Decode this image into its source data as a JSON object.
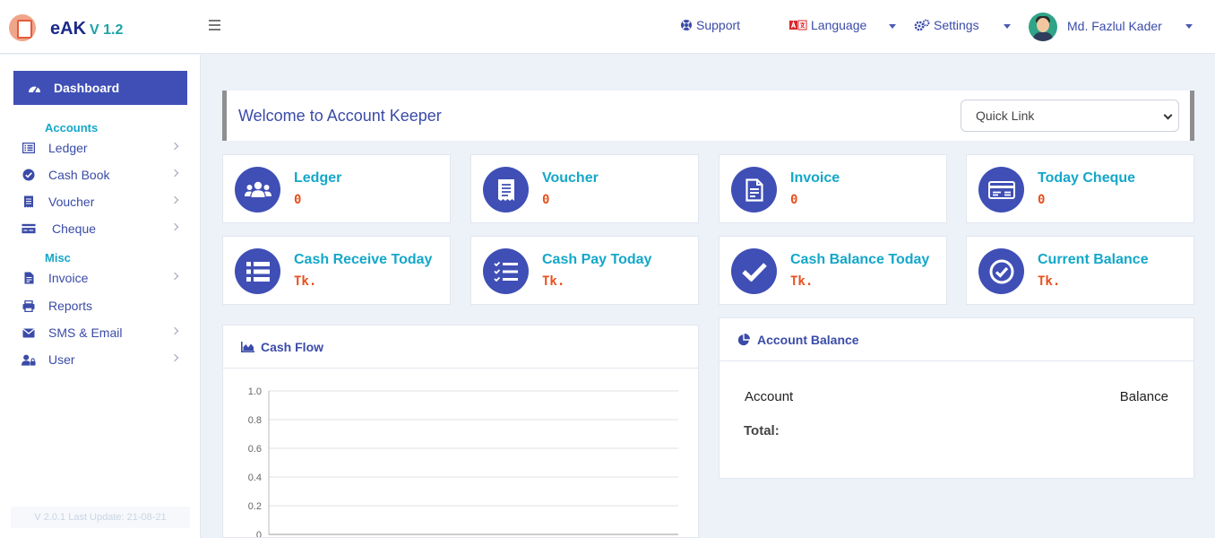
{
  "brand": {
    "name": "eAK",
    "version": "V 1.2"
  },
  "topnav": {
    "support": "Support",
    "language": "Language",
    "settings": "Settings",
    "user_name": "Md. Fazlul Kader"
  },
  "sidebar": {
    "dashboard": "Dashboard",
    "sections": {
      "accounts": "Accounts",
      "misc": "Misc"
    },
    "items": [
      {
        "label": "Ledger",
        "icon": "list-icon"
      },
      {
        "label": "Cash Book",
        "icon": "check-circle-icon"
      },
      {
        "label": "Voucher",
        "icon": "receipt-icon"
      },
      {
        "label": "Cheque",
        "icon": "card-icon"
      },
      {
        "label": "Invoice",
        "icon": "file-icon"
      },
      {
        "label": "Reports",
        "icon": "printer-icon"
      },
      {
        "label": "SMS & Email",
        "icon": "envelope-icon"
      },
      {
        "label": "User",
        "icon": "user-lock-icon"
      }
    ],
    "version_text": "V 2.0.1 Last Update: 21-08-21"
  },
  "welcome": {
    "title": "Welcome to Account Keeper",
    "quick_link": "Quick Link"
  },
  "cards": [
    {
      "title": "Ledger",
      "value": "0"
    },
    {
      "title": "Voucher",
      "value": "0"
    },
    {
      "title": "Invoice",
      "value": "0"
    },
    {
      "title": "Today Cheque",
      "value": "0"
    },
    {
      "title": "Cash Receive Today",
      "value": "Tk."
    },
    {
      "title": "Cash Pay Today",
      "value": "Tk."
    },
    {
      "title": "Cash Balance Today",
      "value": "Tk."
    },
    {
      "title": "Current Balance",
      "value": "Tk."
    }
  ],
  "cashflow": {
    "title": "Cash Flow"
  },
  "account_balance": {
    "title": "Account Balance",
    "col_account": "Account",
    "col_balance": "Balance",
    "total_label": "Total:"
  },
  "colors": {
    "primary": "#3f4fb5",
    "accent": "#14a7c9",
    "value": "#e8501f"
  },
  "chart_data": {
    "type": "line",
    "x": [],
    "series": [],
    "ylim": [
      0,
      1.0
    ],
    "yticks": [
      "1.0",
      "0.8",
      "0.6",
      "0.4",
      "0.2",
      "0"
    ],
    "grid": true
  }
}
